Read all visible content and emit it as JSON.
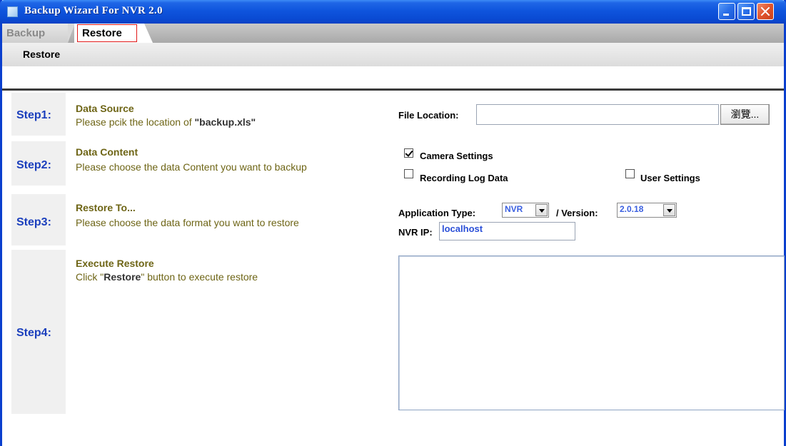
{
  "window": {
    "title": "Backup Wizard For NVR 2.0"
  },
  "tabs": [
    {
      "label": "Backup",
      "active": false
    },
    {
      "label": "Restore",
      "active": true
    }
  ],
  "section": {
    "title": "Restore"
  },
  "steps": [
    {
      "label": "Step1:",
      "title": "Data Source",
      "desc_prefix": "Please pcik the location of ",
      "desc_bold": "\"backup.xls\"",
      "desc_suffix": ""
    },
    {
      "label": "Step2:",
      "title": "Data Content",
      "desc_prefix": "Please choose the data Content you want to backup",
      "desc_bold": "",
      "desc_suffix": ""
    },
    {
      "label": "Step3:",
      "title": "Restore To...",
      "desc_prefix": "Please choose the data format you want to restore",
      "desc_bold": "",
      "desc_suffix": ""
    },
    {
      "label": "Step4:",
      "title": "Execute Restore",
      "desc_prefix": "Click \"",
      "desc_bold": "Restore",
      "desc_suffix": "\" button to execute restore"
    }
  ],
  "file_location": {
    "label": "File Location:",
    "value": "",
    "browse_label": "瀏覽..."
  },
  "data_content": {
    "camera_settings": {
      "label": "Camera Settings",
      "checked": true
    },
    "recording_log": {
      "label": "Recording Log Data",
      "checked": false
    },
    "user_settings": {
      "label": "User Settings",
      "checked": false
    }
  },
  "restore_to": {
    "app_type_label": "Application Type:",
    "app_type_value": "NVR",
    "version_label": "/ Version:",
    "version_value": "2.0.18",
    "ip_label": "NVR IP:",
    "ip_value": "localhost"
  },
  "log": {
    "value": ""
  },
  "colors": {
    "titlebar": "#0a4ad3",
    "step_label": "#1b3fbd",
    "step_text": "#6e6516",
    "input_text": "#2a4fd8",
    "active_tab_border": "#e01818"
  }
}
